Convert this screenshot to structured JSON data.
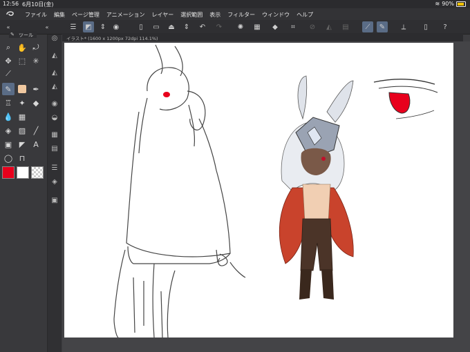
{
  "status_bar": {
    "time": "12:56",
    "date": "6月10日(金)",
    "battery": "90%",
    "battery_level": 0.9
  },
  "menu": {
    "items": [
      "ファイル",
      "編集",
      "ページ管理",
      "アニメーション",
      "レイヤー",
      "選択範囲",
      "表示",
      "フィルター",
      "ウィンドウ",
      "ヘルプ"
    ]
  },
  "tool_palette": {
    "title": "ツール"
  },
  "colors": {
    "main": "#e8001c",
    "sub": "#ffffff",
    "selection": "#5a6c86"
  },
  "canvas": {
    "tab_label": "イラスト* (1600 x 1200px 72dpi 114.1%)"
  }
}
